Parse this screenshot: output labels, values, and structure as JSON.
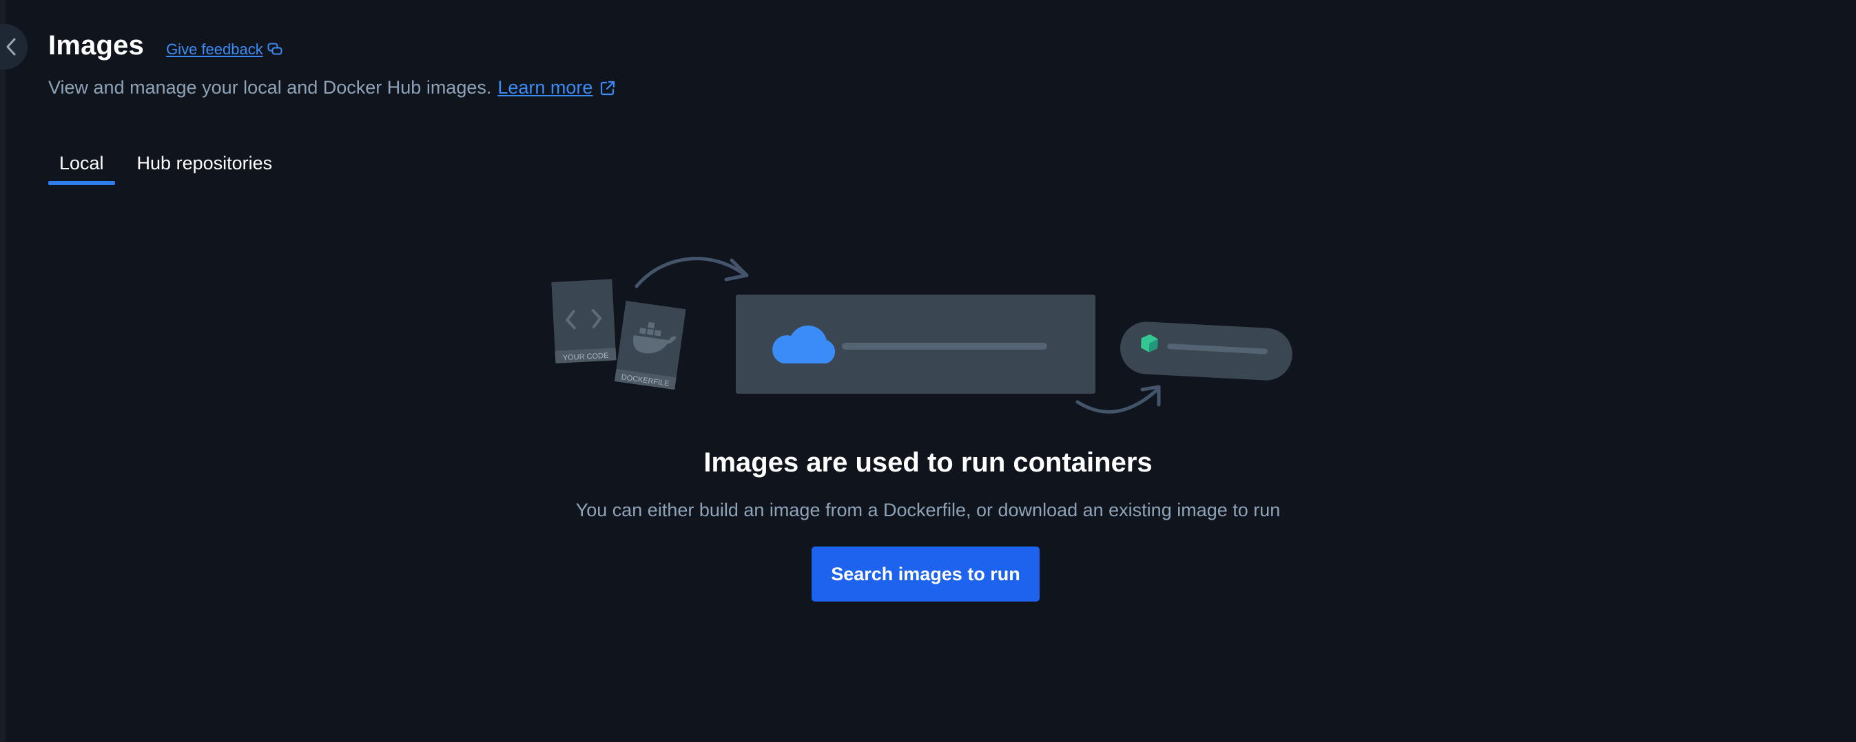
{
  "header": {
    "title": "Images",
    "feedback_label": "Give feedback",
    "subtitle": "View and manage your local and Docker Hub images.",
    "learn_more_label": "Learn more"
  },
  "tabs": [
    {
      "label": "Local",
      "active": true
    },
    {
      "label": "Hub repositories",
      "active": false
    }
  ],
  "illustration": {
    "code_card_label": "YOUR CODE",
    "dockerfile_card_label": "DOCKERFILE"
  },
  "empty_state": {
    "title": "Images are used to run containers",
    "description": "You can either build an image from a Dockerfile, or download an existing image to run",
    "button_label": "Search images to run"
  },
  "colors": {
    "background": "#10141c",
    "accent": "#1d63ed",
    "link": "#3b8cf6",
    "muted_text": "#8fa3b8"
  },
  "icons": {
    "back": "chevron-left-icon",
    "feedback": "chat-bubbles-icon",
    "external": "external-link-icon"
  }
}
